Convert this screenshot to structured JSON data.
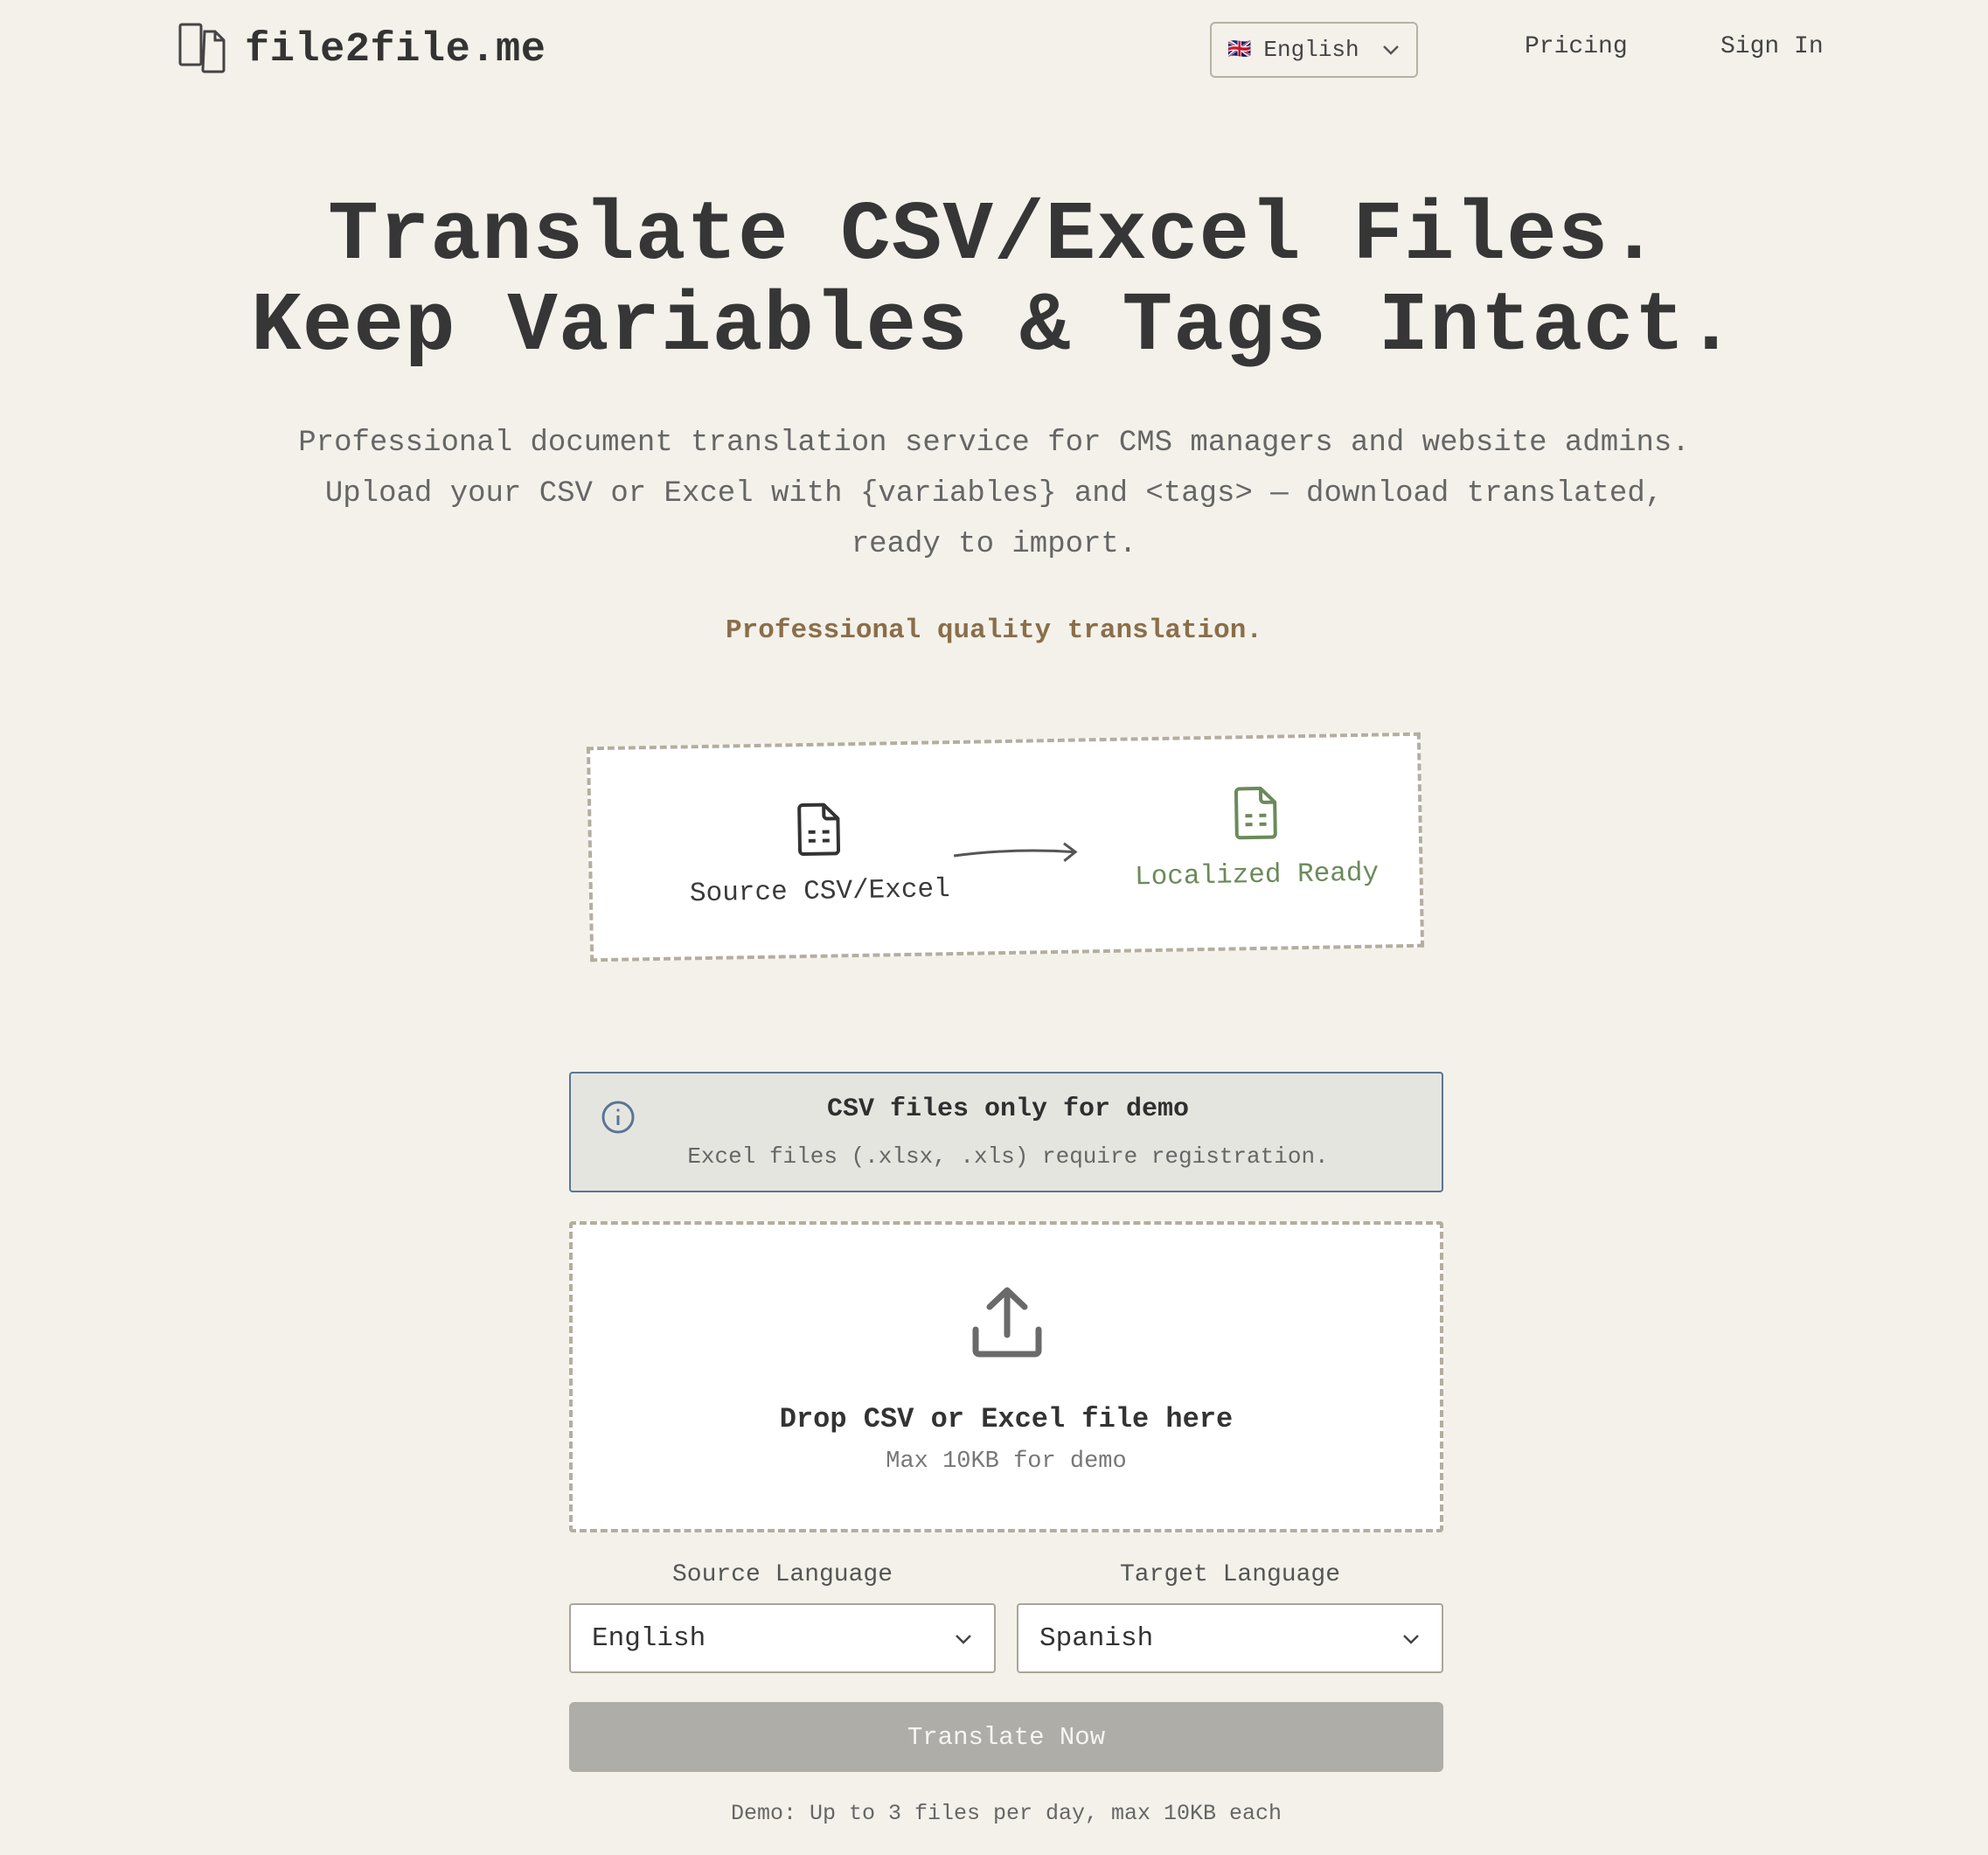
{
  "header": {
    "brand": "file2file.me",
    "language_selector": {
      "flag": "🇬🇧",
      "label": "English"
    },
    "nav": {
      "pricing": "Pricing",
      "sign_in": "Sign In"
    }
  },
  "hero": {
    "title_line1": "Translate CSV/Excel Files.",
    "title_line2": "Keep Variables & Tags Intact.",
    "subtitle_line1": "Professional document translation service for CMS managers and website admins.",
    "subtitle_line2": "Upload your CSV or Excel with {variables} and <tags> — download translated,",
    "subtitle_line3": "ready to import.",
    "quality_note": "Professional quality translation."
  },
  "flow": {
    "source_label": "Source CSV/Excel",
    "target_label": "Localized Ready"
  },
  "notice": {
    "title": "CSV files only for demo",
    "text": "Excel files (.xlsx, .xls) require registration."
  },
  "dropzone": {
    "title": "Drop CSV or Excel file here",
    "subtitle": "Max 10KB for demo"
  },
  "languages": {
    "source_label": "Source Language",
    "source_value": "English",
    "target_label": "Target Language",
    "target_value": "Spanish"
  },
  "actions": {
    "translate_label": "Translate Now",
    "demo_note": "Demo: Up to 3 files per day, max 10KB each"
  },
  "colors": {
    "background": "#f3f1ea",
    "accent_green": "#6b8a5a",
    "accent_brown": "#8a6e4a",
    "notice_border": "#5a7595",
    "button_disabled": "#aeada8"
  }
}
